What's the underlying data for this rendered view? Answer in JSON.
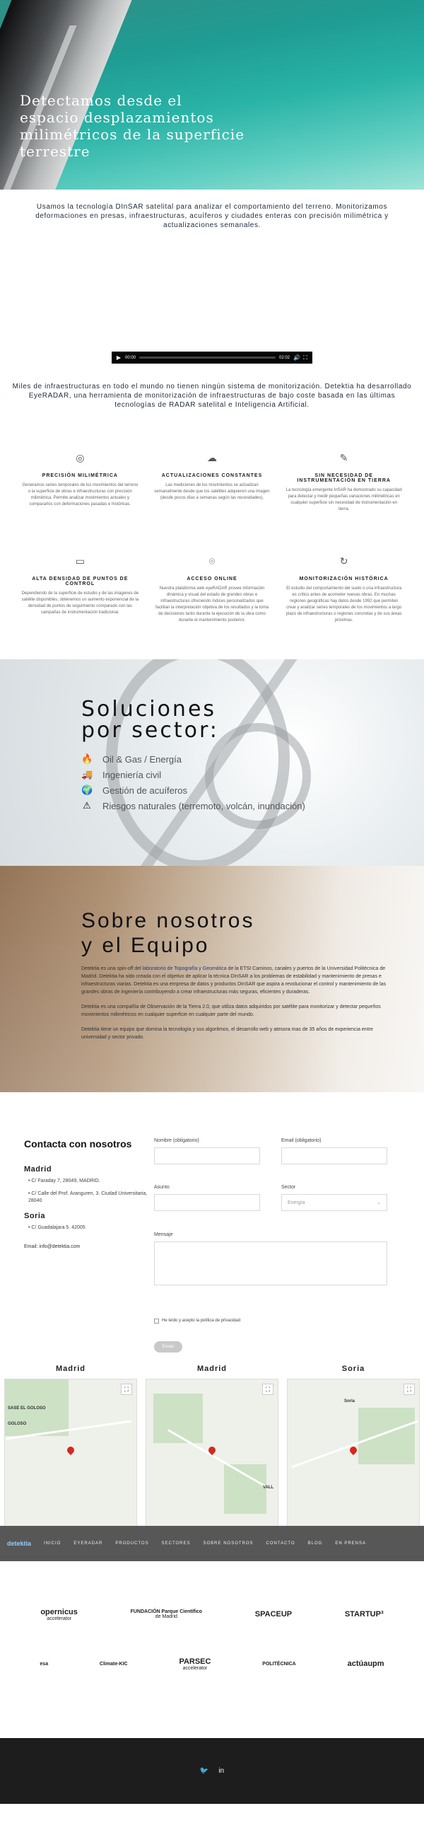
{
  "hero": {
    "title": "Detectamos desde el espacio desplazamientos milimétricos de la superficie terrestre"
  },
  "intro": {
    "text": "Usamos la tecnología DInSAR satelital para analizar el comportamiento del terreno. Monitorizamos deformaciones en presas, infraestructuras, acuíferos y ciudades enteras con precisión milimétrica y actualizaciones semanales."
  },
  "video": {
    "current_time": "00:00",
    "duration": "02:02"
  },
  "mission": {
    "text": "Miles de infraestructuras en todo el mundo no tienen ningún sistema de monitorización. Detektia ha desarrollado EyeRADAR, una herramienta de monitorización de infraestructuras de bajo coste basada en las últimas tecnologías de RADAR satelital e Inteligencia Artificial."
  },
  "features": [
    {
      "icon": "target-icon",
      "glyph": "◎",
      "title": "PRECISIÓN MILIMÉTRICA",
      "text": "Generamos series temporales de los movimientos del terreno o la superficie de obras e infraestructuras con precisión milimétrica. Permite analizar movimientos actuales y compararlos con deformaciones pasadas e históricas."
    },
    {
      "icon": "cloud-icon",
      "glyph": "☁",
      "title": "ACTUALIZACIONES CONSTANTES",
      "text": "Las mediciones de los movimientos se actualizan semanalmente desde que los satélites adquieren una imagen (desde pocos días a semanas según las necesidades)."
    },
    {
      "icon": "pen-icon",
      "glyph": "✎",
      "title": "SIN NECESIDAD DE INSTRUMENTACIÓN EN TIERRA",
      "text": "La tecnología emergente InSAR ha demostrado su capacidad para detectar y medir pequeñas variaciones milimétricas en cualquier superficie sin necesidad de instrumentación en tierra."
    },
    {
      "icon": "density-icon",
      "glyph": "▭",
      "title": "ALTA DENSIDAD DE PUNTOS DE CONTROL",
      "text": "Dependiendo de la superficie de estudio y de las imágenes de satélite disponibles, obtenemos un aumento exponencial de la densidad de puntos de seguimiento comparado con las campañas de instrumentación tradicional."
    },
    {
      "icon": "location-icon",
      "glyph": "⌾",
      "title": "ACCESO ONLINE",
      "text": "Nuestra plataforma web eyeRADAR provee información dinámica y visual del estado de grandes obras e infraestructuras ofreciendo índices personalizados que facilitan la interpretación objetiva de los resultados y la toma de decisiones tanto durante la ejecución de la obra como durante el mantenimiento posterior."
    },
    {
      "icon": "history-icon",
      "glyph": "↻",
      "title": "MONITORIZACIÓN HISTÓRICA",
      "text": "El estudio del comportamiento del suelo o una infraestructura es crítico antes de acometer nuevas obras. En muchas regiones geográficas hay datos desde 1992 que permiten crear y analizar series temporales de los movimientos a largo plazo de infraestructuras o regiones concretas y de sus áreas próximas."
    }
  ],
  "sectors": {
    "title": "Soluciones\npor sector:",
    "items": [
      {
        "icon": "flame-icon",
        "glyph": "🔥",
        "label": "Oil & Gas / Energía"
      },
      {
        "icon": "truck-icon",
        "glyph": "🚚",
        "label": "Ingeniería civil"
      },
      {
        "icon": "globe-icon",
        "glyph": "🌍",
        "label": "Gestión de acuíferos"
      },
      {
        "icon": "disaster-icon",
        "glyph": "⚠",
        "label": "Riesgos naturales (terremoto, volcán, inundación)"
      }
    ]
  },
  "about": {
    "title": "Sobre nosotros\ny el Equipo",
    "p1_prefix": "Detektia es una spin-off del ",
    "p1_link": "laboratorio de Topografía y Geomática",
    "p1_suffix": " de la ETSI Caminos, canales y puertos de la Universidad Politécnica de Madrid. Detektia ha sido creada con el objetivo de aplicar la técnica DInSAR a los problemas de estabilidad y mantenimiento de presas e infraestructuras viarias. Detektia es una empresa de datos y productos DInSAR que aspira a revolucionar el control y mantenimiento de las grandes obras de ingeniería contribuyendo a crear infraestructuras más seguras, eficientes y duraderas.",
    "p2": "Detektia es una compañía de Observación de la Tierra 2.0, que utiliza datos adquiridos por satélite para monitorizar y detectar pequeños movimientos milimétricos en cualquier superficie en cualquier parte del mundo.",
    "p3": "Detektia tiene un equipo que domina la tecnología y sus algoritmos, el desarrollo web y atesora mas de 35 años de experiencia entre universidad y sector privado."
  },
  "contact": {
    "title": "Contacta con nosotros",
    "madrid_heading": "Madrid",
    "madrid_addr1": "C/ Faraday 7, 28049, MADRID.",
    "madrid_addr2": "C/ Calle del Prof. Aranguren, 3. Ciudad Universitaria, 28040",
    "soria_heading": "Soria",
    "soria_addr": "C/ Guadalajara 5. 42005",
    "email": "Email: info@detektia.com",
    "form": {
      "name_label": "Nombre (obligatorio)",
      "email_label": "Email (obligatorio)",
      "subject_label": "Asunto",
      "sector_label": "Sector",
      "sector_value": "Energía",
      "message_label": "Mensaje",
      "privacy_label": "He leído y acepto la política de privacidad",
      "send_label": "Enviar"
    }
  },
  "maps": [
    {
      "title": "Madrid",
      "labels": [
        "SASE EL GOLOSO",
        "GOLOSO"
      ]
    },
    {
      "title": "Madrid",
      "labels": [
        "VALL"
      ]
    },
    {
      "title": "Soria",
      "labels": [
        "Soria"
      ]
    }
  ],
  "navbar": {
    "logo": "detektia",
    "items": [
      "INICIO",
      "EYERADAR",
      "PRODUCTOS",
      "SECTORES",
      "SOBRE NOSOTROS",
      "CONTACTO",
      "BLOG",
      "EN PRENSA"
    ]
  },
  "partners": {
    "row1": [
      {
        "icon": "copernicus-logo",
        "name": "opernicus",
        "sub": "accelerator"
      },
      {
        "icon": "fpcm-logo",
        "name": "FUNDACIÓN Parque Científico",
        "sub": "de Madrid"
      },
      {
        "icon": "spaceup-logo",
        "name": "SPACEUP",
        "sub": ""
      },
      {
        "icon": "startup3-logo",
        "name": "STARTUP³",
        "sub": ""
      }
    ],
    "row2": [
      {
        "icon": "esa-logo",
        "name": "esa",
        "sub": ""
      },
      {
        "icon": "climate-kic-logo",
        "name": "Climate-KIC",
        "sub": ""
      },
      {
        "icon": "parsec-logo",
        "name": "PARSEC",
        "sub": "accelerator"
      },
      {
        "icon": "politecnica-logo",
        "name": "POLITÉCNICA",
        "sub": ""
      },
      {
        "icon": "actuaupm-logo",
        "name": "actúaupm",
        "sub": ""
      }
    ]
  },
  "footer": {
    "twitter": "🐦",
    "linkedin": "in"
  },
  "colors": {
    "accent": "#29b3a6",
    "dark": "#1d1d1d",
    "nav": "#4f4f4f",
    "pin": "#d9271c"
  }
}
